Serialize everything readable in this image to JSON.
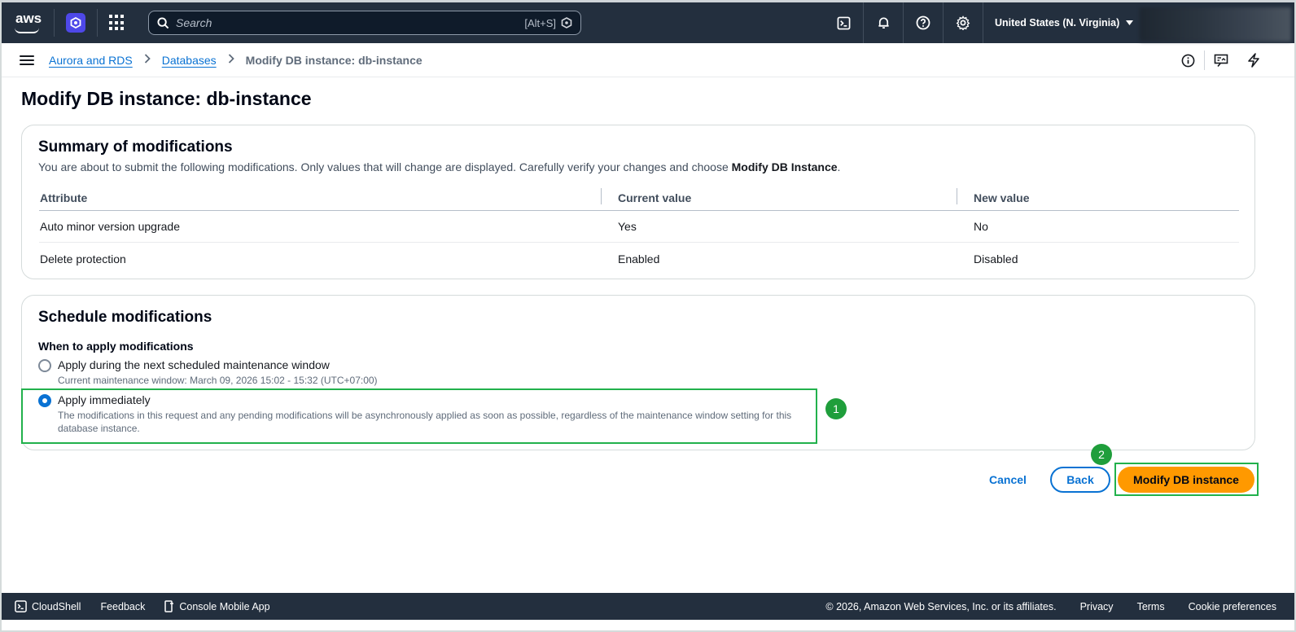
{
  "topnav": {
    "logo_text": "aws",
    "search_placeholder": "Search",
    "search_shortcut": "[Alt+S]",
    "region": "United States (N. Virginia)"
  },
  "breadcrumb": {
    "items": [
      "Aurora and RDS",
      "Databases"
    ],
    "current": "Modify DB instance: db-instance"
  },
  "page": {
    "title": "Modify DB instance: db-instance"
  },
  "summary": {
    "title": "Summary of modifications",
    "description_prefix": "You are about to submit the following modifications. Only values that will change are displayed. Carefully verify your changes and choose ",
    "description_bold": "Modify DB Instance",
    "description_suffix": ".",
    "columns": [
      "Attribute",
      "Current value",
      "New value"
    ],
    "rows": [
      [
        "Auto minor version upgrade",
        "Yes",
        "No"
      ],
      [
        "Delete protection",
        "Enabled",
        "Disabled"
      ]
    ]
  },
  "schedule": {
    "title": "Schedule modifications",
    "label": "When to apply modifications",
    "options": [
      {
        "label": "Apply during the next scheduled maintenance window",
        "description": "Current maintenance window: March 09, 2026 15:02 - 15:32 (UTC+07:00)",
        "selected": false
      },
      {
        "label": "Apply immediately",
        "description": "The modifications in this request and any pending modifications will be asynchronously applied as soon as possible, regardless of the maintenance window setting for this database instance.",
        "selected": true
      }
    ]
  },
  "annotations": {
    "badge1": "1",
    "badge2": "2",
    "highlight_color": "#22b14c"
  },
  "actions": {
    "cancel": "Cancel",
    "back": "Back",
    "primary": "Modify DB instance"
  },
  "footer": {
    "cloudshell": "CloudShell",
    "feedback": "Feedback",
    "mobile_app": "Console Mobile App",
    "copyright": "© 2026, Amazon Web Services, Inc. or its affiliates.",
    "privacy": "Privacy",
    "terms": "Terms",
    "cookies": "Cookie preferences"
  },
  "colors": {
    "nav_bg": "#232f3e",
    "link": "#0972d3",
    "primary_button": "#ff9900"
  }
}
